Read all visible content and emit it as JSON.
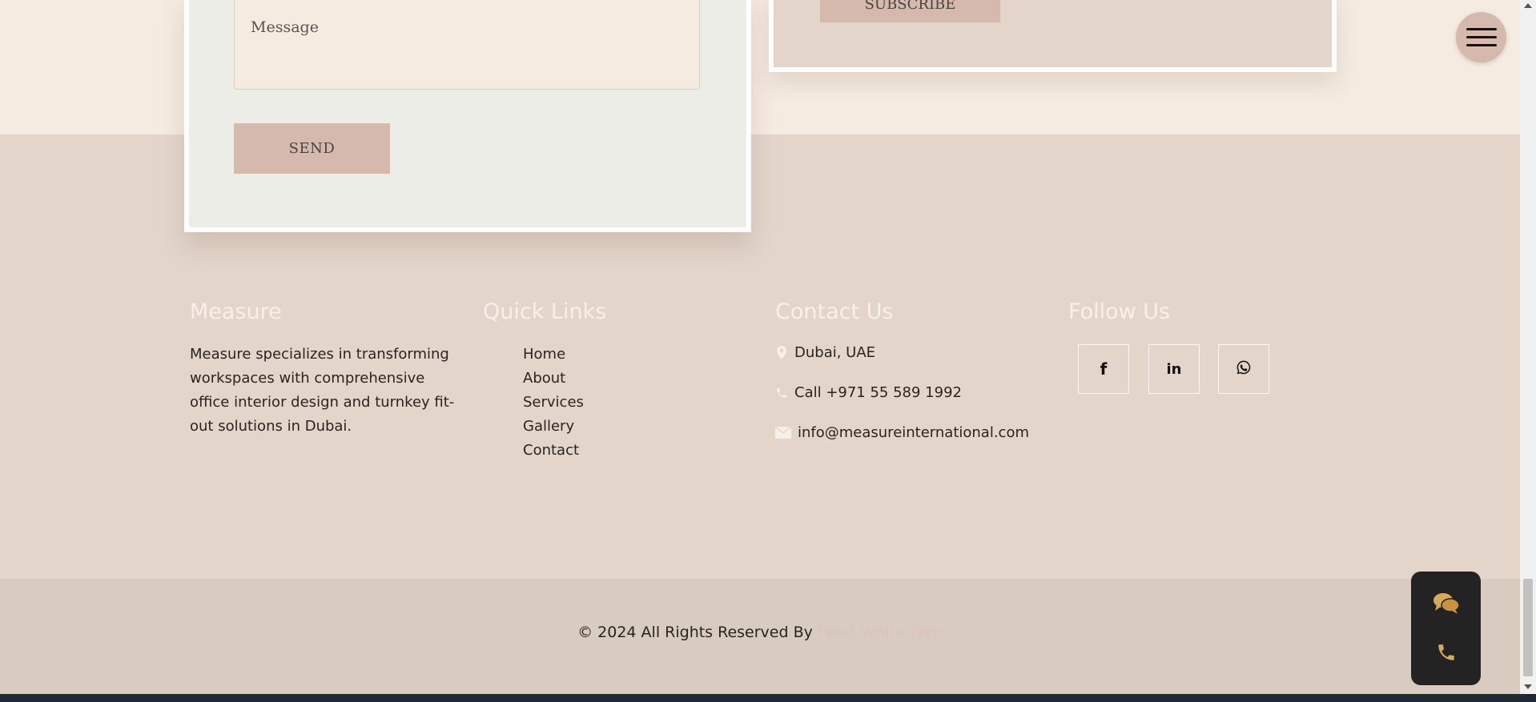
{
  "form": {
    "message_placeholder": "Message",
    "send_label": "SEND"
  },
  "newsletter": {
    "subscribe_label": "SUBSCRIBE"
  },
  "footer": {
    "about": {
      "title": "Measure",
      "text": "Measure specializes in transforming workspaces with comprehensive office interior design and turnkey fit-out solutions in Dubai."
    },
    "quick_links": {
      "title": "Quick Links",
      "items": [
        "Home",
        "About",
        "Services",
        "Gallery",
        "Contact"
      ]
    },
    "contact": {
      "title": "Contact Us",
      "location": "Dubai, UAE",
      "phone": "Call +971 55 589 1992",
      "email": "info@measureinternational.com"
    },
    "follow": {
      "title": "Follow Us",
      "icons": [
        "facebook-icon",
        "linkedin-icon",
        "whatsapp-icon"
      ]
    }
  },
  "copyright": {
    "text": "© 2024 All Rights Reserved By",
    "brand": "Pearl White Web"
  },
  "colors": {
    "cream": "#f5ebe1",
    "footer": "#e3d5ca",
    "accent": "#d6b9ad",
    "gold": "#d9a95a"
  }
}
